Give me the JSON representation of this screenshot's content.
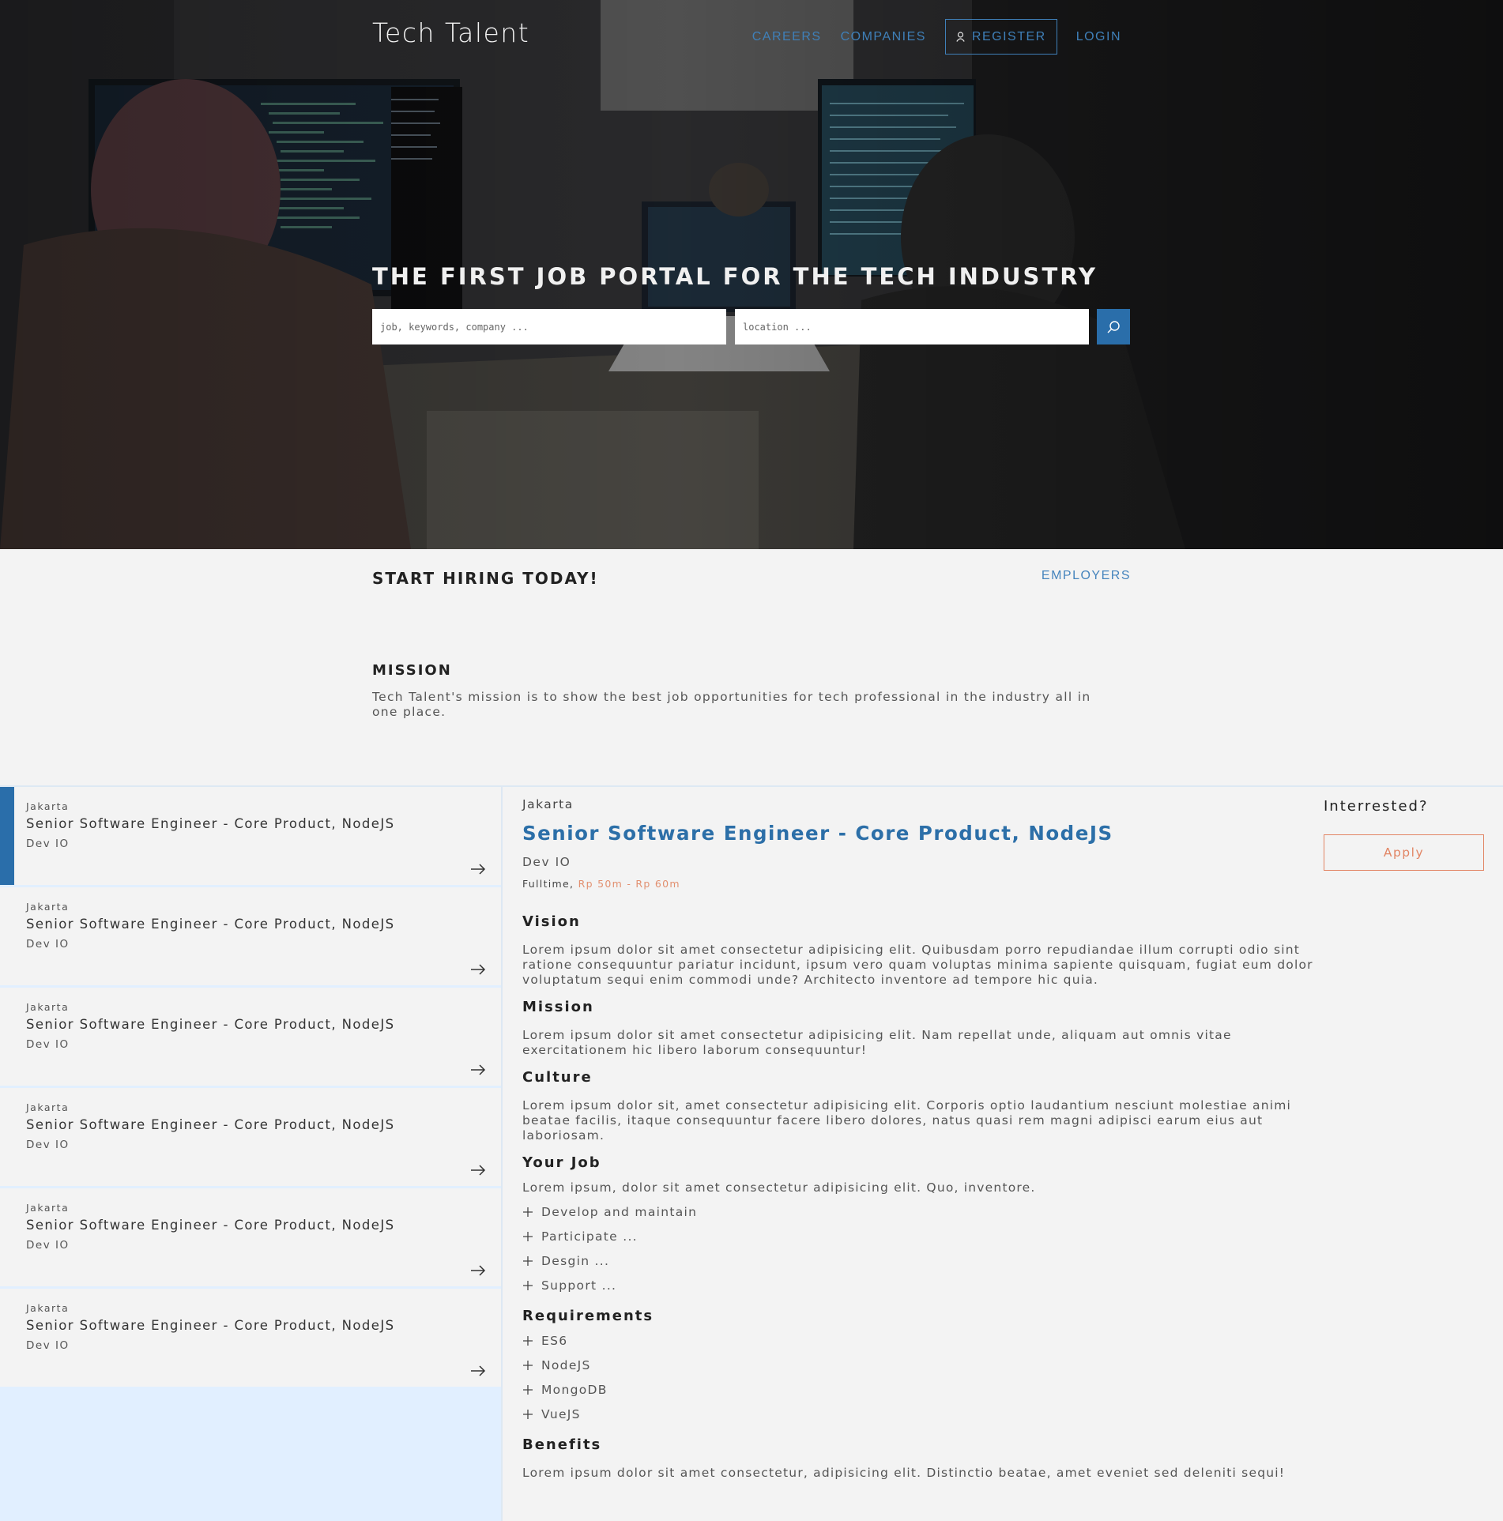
{
  "header": {
    "brand": "Tech Talent",
    "nav": {
      "careers": "CAREERS",
      "companies": "COMPANIES",
      "register": "REGISTER",
      "login": "LOGIN"
    }
  },
  "hero": {
    "title": "THE FIRST JOB PORTAL FOR THE TECH INDUSTRY",
    "search_placeholder": "job, keywords, company ...",
    "location_placeholder": "location ..."
  },
  "hiring": {
    "title": "START HIRING TODAY!",
    "employers_link": "EMPLOYERS"
  },
  "mission": {
    "title": "MISSION",
    "text": "Tech Talent's mission is to show the best job opportunities for tech professional in the industry all in one place."
  },
  "job_list": [
    {
      "location": "Jakarta",
      "title": "Senior Software Engineer - Core Product, NodeJS",
      "company": "Dev IO",
      "active": true
    },
    {
      "location": "Jakarta",
      "title": "Senior Software Engineer - Core Product, NodeJS",
      "company": "Dev IO",
      "active": false
    },
    {
      "location": "Jakarta",
      "title": "Senior Software Engineer - Core Product, NodeJS",
      "company": "Dev IO",
      "active": false
    },
    {
      "location": "Jakarta",
      "title": "Senior Software Engineer - Core Product, NodeJS",
      "company": "Dev IO",
      "active": false
    },
    {
      "location": "Jakarta",
      "title": "Senior Software Engineer - Core Product, NodeJS",
      "company": "Dev IO",
      "active": false
    },
    {
      "location": "Jakarta",
      "title": "Senior Software Engineer - Core Product, NodeJS",
      "company": "Dev IO",
      "active": false
    }
  ],
  "detail": {
    "location": "Jakarta",
    "title": "Senior Software Engineer - Core Product, NodeJS",
    "company": "Dev IO",
    "employment_type": "Fulltime,",
    "salary": "Rp 50m - Rp 60m",
    "vision": {
      "heading": "Vision",
      "text": "Lorem ipsum dolor sit amet consectetur adipisicing elit. Quibusdam porro repudiandae illum corrupti odio sint ratione consequuntur pariatur incidunt, ipsum vero quam voluptas minima sapiente quisquam, fugiat eum dolor voluptatum sequi enim commodi unde? Architecto inventore ad tempore hic quia."
    },
    "mission": {
      "heading": "Mission",
      "text": "Lorem ipsum dolor sit amet consectetur adipisicing elit. Nam repellat unde, aliquam aut omnis vitae exercitationem hic libero laborum consequuntur!"
    },
    "culture": {
      "heading": "Culture",
      "text": "Lorem ipsum dolor sit, amet consectetur adipisicing elit. Corporis optio laudantium nesciunt molestiae animi beatae facilis, itaque consequuntur facere libero dolores, natus quasi rem magni adipisci earum eius aut laboriosam."
    },
    "your_job": {
      "heading": "Your Job",
      "text": "Lorem ipsum, dolor sit amet consectetur adipisicing elit. Quo, inventore.",
      "items": [
        "Develop and maintain",
        "Participate ...",
        "Desgin ...",
        "Support ..."
      ]
    },
    "requirements": {
      "heading": "Requirements",
      "items": [
        "ES6",
        "NodeJS",
        "MongoDB",
        "VueJS"
      ]
    },
    "benefits": {
      "heading": "Benefits",
      "text": "Lorem ipsum dolor sit amet consectetur, adipisicing elit. Distinctio beatae, amet eveniet sed deleniti sequi!"
    }
  },
  "aside": {
    "title": "Interrested?",
    "apply": "Apply"
  },
  "colors": {
    "accent_blue": "#2a6eaa",
    "link_blue": "#3f80b9",
    "salary_orange": "#e29070",
    "apply_orange": "#e28564",
    "list_bg": "#e1efff"
  },
  "icons": {
    "register": "user-icon",
    "search": "search-icon",
    "job_arrow": "arrow-right-icon",
    "bullet": "plus-icon"
  }
}
